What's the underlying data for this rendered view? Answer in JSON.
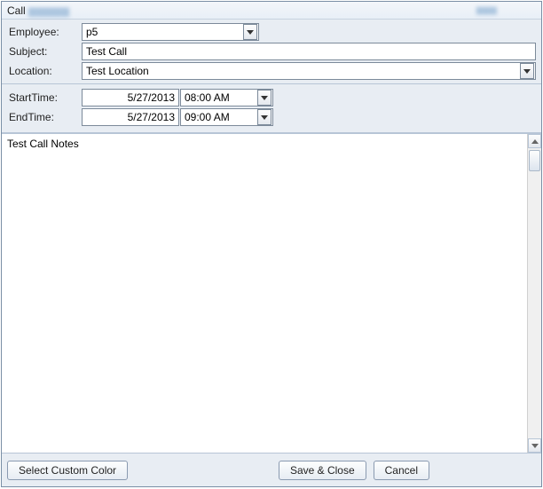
{
  "window": {
    "title": "Call"
  },
  "form": {
    "employee_label": "Employee:",
    "employee_value": "p5",
    "subject_label": "Subject:",
    "subject_value": "Test Call",
    "location_label": "Location:",
    "location_value": "Test Location"
  },
  "time": {
    "start_label": "StartTime:",
    "start_date": "5/27/2013",
    "start_time": "08:00 AM",
    "end_label": "EndTime:",
    "end_date": "5/27/2013",
    "end_time": "09:00 AM"
  },
  "notes": {
    "value": "Test Call Notes"
  },
  "footer": {
    "custom_color": "Select Custom Color",
    "save_close": "Save & Close",
    "cancel": "Cancel"
  }
}
